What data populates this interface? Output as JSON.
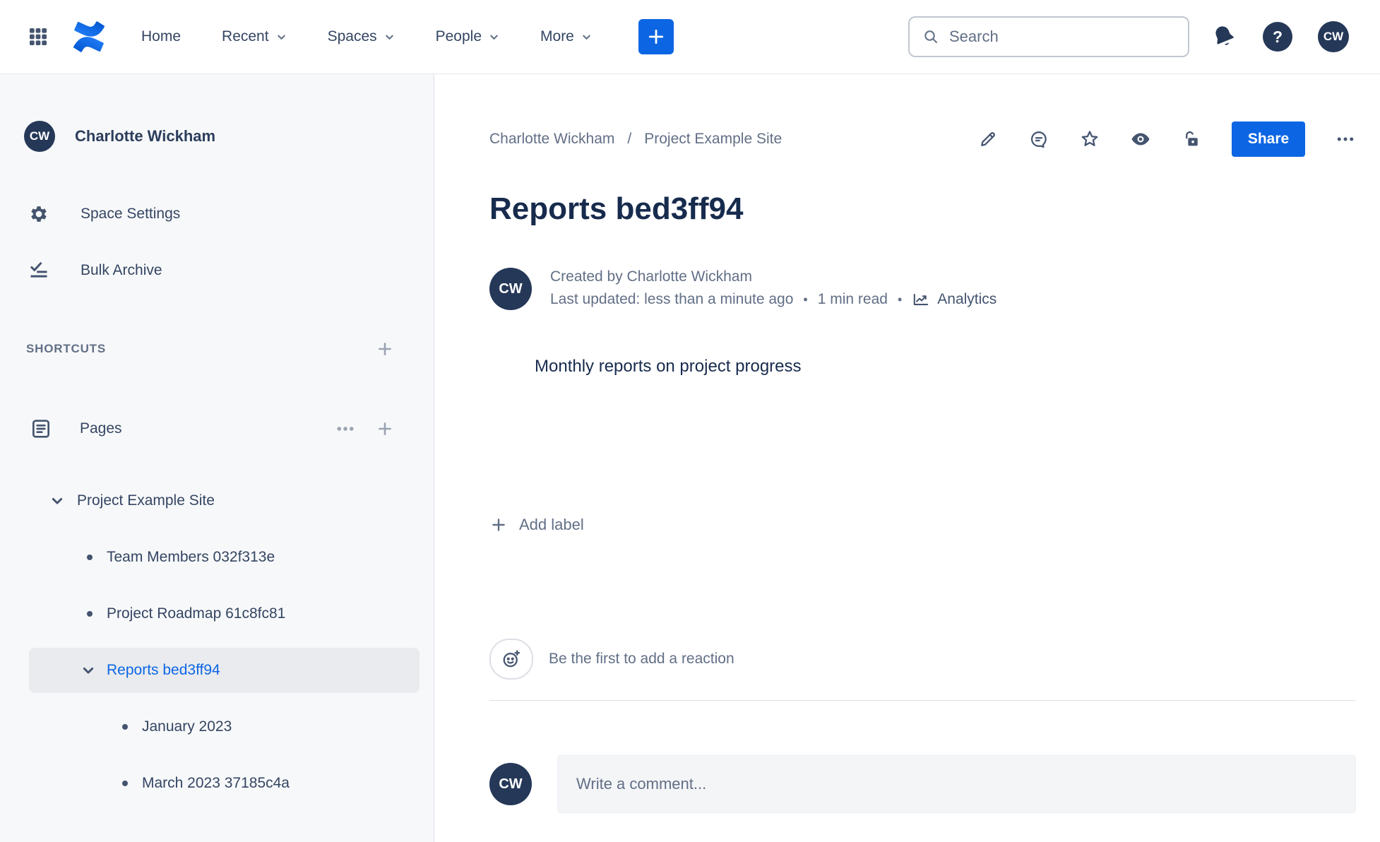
{
  "topnav": {
    "items": [
      "Home",
      "Recent",
      "Spaces",
      "People",
      "More"
    ],
    "search_placeholder": "Search",
    "help_glyph": "?",
    "avatar_initials": "CW"
  },
  "sidebar": {
    "profile_initials": "CW",
    "profile_name": "Charlotte Wickham",
    "menu": {
      "space_settings": "Space Settings",
      "bulk_archive": "Bulk Archive"
    },
    "shortcuts_header": "SHORTCUTS",
    "pages_label": "Pages",
    "tree": {
      "root": "Project Example Site",
      "items": [
        "Team Members 032f313e",
        "Project Roadmap 61c8fc81"
      ],
      "selected": "Reports bed3ff94",
      "children": [
        "January 2023",
        "March 2023 37185c4a"
      ]
    }
  },
  "content": {
    "breadcrumbs": [
      "Charlotte Wickham",
      "Project Example Site"
    ],
    "breadcrumb_separator": "/",
    "share_label": "Share",
    "title": "Reports bed3ff94",
    "byline": {
      "avatar_initials": "CW",
      "created_by": "Created by Charlotte Wickham",
      "last_updated": "Last updated: less than a minute ago",
      "separator": "•",
      "read_time": "1 min read",
      "analytics_label": "Analytics"
    },
    "body_text": "Monthly reports on project progress",
    "add_label_text": "Add label",
    "reaction_text": "Be the first to add a reaction",
    "comment": {
      "avatar_initials": "CW",
      "placeholder": "Write a comment..."
    }
  },
  "colors": {
    "accent_blue": "#0C66E4",
    "text_primary": "#172B4D",
    "text_secondary": "#626F86",
    "icon_navy": "#44546F",
    "avatar_navy": "#253858",
    "sidebar_bg": "#F7F8F9",
    "selected_row_bg": "#E9EBEE"
  }
}
